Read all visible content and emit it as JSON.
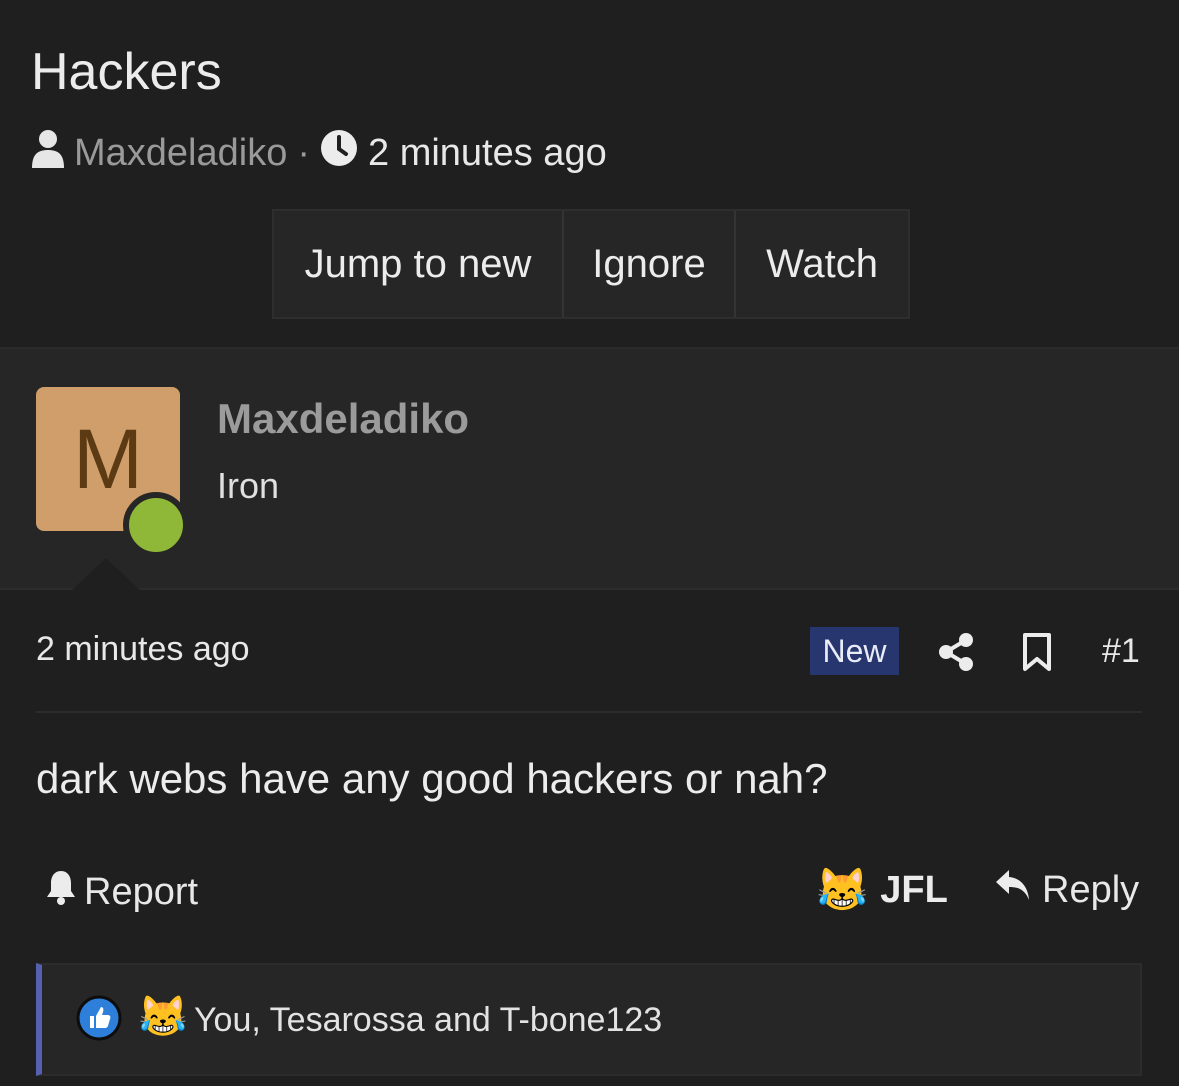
{
  "thread": {
    "title": "Hackers",
    "author": "Maxdeladiko",
    "separator": "·",
    "time": "2 minutes ago"
  },
  "toolbar": {
    "jump_label": "Jump to new",
    "ignore_label": "Ignore",
    "watch_label": "Watch"
  },
  "user": {
    "avatar_letter": "M",
    "name": "Maxdeladiko",
    "rank": "Iron",
    "avatar_color": "#cf9e6a",
    "online_color": "#8fb838"
  },
  "post": {
    "time": "2 minutes ago",
    "badge": "New",
    "number": "#1",
    "body": "dark webs have any good hackers or nah?",
    "badge_color": "#27366f"
  },
  "actions": {
    "report_label": "Report",
    "reaction_emoji": "😹",
    "reaction_label": "JFL",
    "reply_label": "Reply"
  },
  "reactions": {
    "like_icon": "thumbs-up-icon",
    "laugh_emoji": "😹",
    "summary": "You, Tesarossa and T-bone123"
  },
  "icons": {
    "user": "user-icon",
    "clock": "clock-icon",
    "share": "share-icon",
    "bookmark": "bookmark-icon",
    "bell": "bell-icon",
    "reply": "reply-arrow-icon"
  }
}
